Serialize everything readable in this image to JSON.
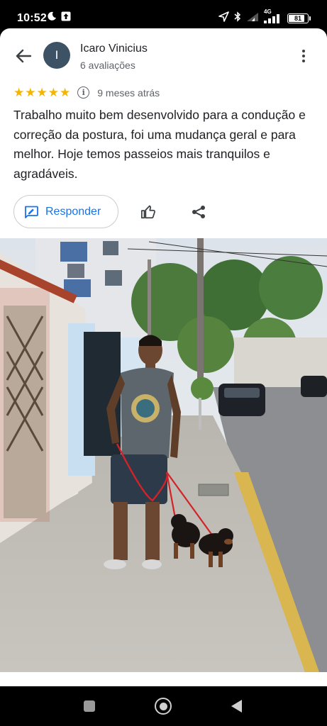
{
  "status_bar": {
    "time": "10:52",
    "network": "4G",
    "battery": "81",
    "icons": [
      "moon-icon",
      "upload-icon",
      "location-arrow-icon",
      "bluetooth-icon",
      "wifi-icon",
      "signal-icon",
      "battery-icon"
    ]
  },
  "review": {
    "avatar_letter": "I",
    "user_name": "Icaro Vinicius",
    "review_count": "6 avaliações",
    "rating": 5,
    "stars": [
      "★",
      "★",
      "★",
      "★",
      "★"
    ],
    "time_ago": "9 meses atrás",
    "text": "Trabalho muito bem desenvolvido para a condução e correção da postura, foi uma mudança geral e para melhor. Hoje temos passeios mais tranquilos e agradáveis.",
    "info_symbol": "i"
  },
  "actions": {
    "reply_label": "Responder"
  },
  "colors": {
    "accent": "#1a73e8",
    "star": "#f4b400",
    "avatar_bg": "#3e5266"
  }
}
